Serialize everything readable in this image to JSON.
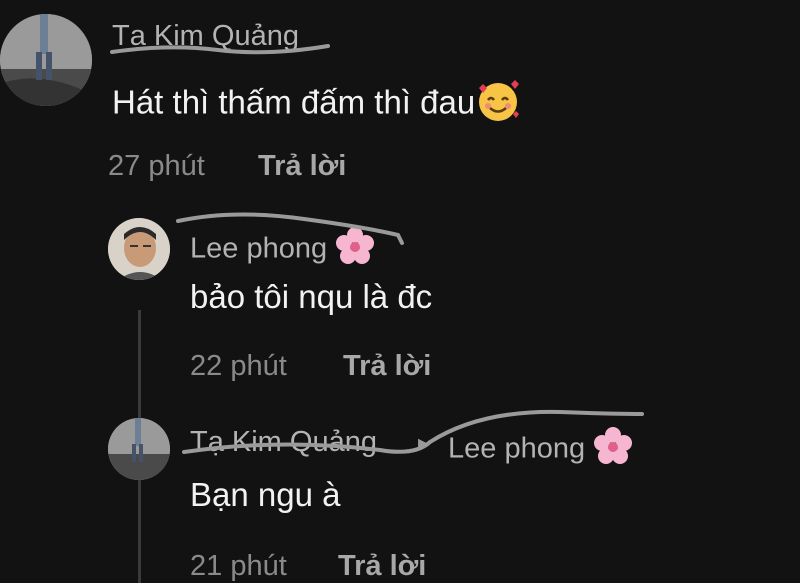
{
  "comments": [
    {
      "author": "Tạ Kim Quảng",
      "text": "Hát thì thấm đấm thì đau",
      "emoji": "smiling-face-with-hearts",
      "time": "27 phút",
      "reply_label": "Trả lời"
    },
    {
      "author": "Lee phong",
      "author_emoji": "cherry-blossom",
      "text": "bảo tôi nqu là đc",
      "time": "22 phút",
      "reply_label": "Trả lời"
    },
    {
      "author": "Tạ Kim Quảng",
      "reply_to": "Lee phong",
      "reply_to_emoji": "cherry-blossom",
      "text": "Bạn ngu à",
      "time": "21 phút",
      "reply_label": "Trả lời"
    }
  ],
  "colors": {
    "background": "#121212",
    "text": "#f2f2f2",
    "name": "#b3b3b3",
    "meta": "#8a8a8a",
    "scribble": "#9a9a9a"
  }
}
